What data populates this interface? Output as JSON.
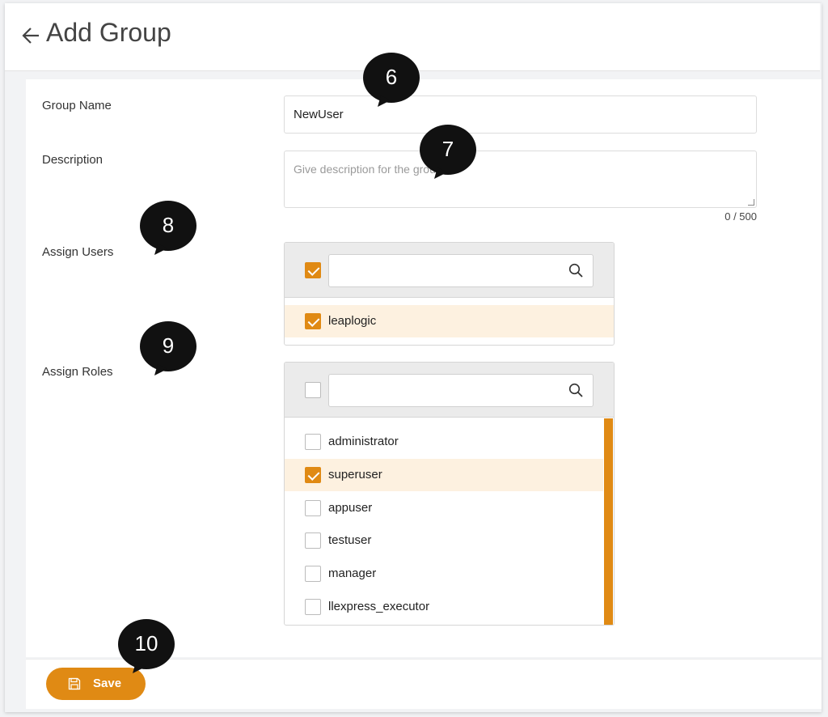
{
  "header": {
    "title": "Add Group",
    "back_icon": "arrow-left-icon"
  },
  "form": {
    "group_name": {
      "label": "Group Name",
      "value": "NewUser"
    },
    "description": {
      "label": "Description",
      "placeholder": "Give description for the group",
      "counter": "0 / 500"
    },
    "assign_users": {
      "label": "Assign Users",
      "select_all_checked": true,
      "items": [
        {
          "label": "leaplogic",
          "checked": true
        }
      ]
    },
    "assign_roles": {
      "label": "Assign Roles",
      "select_all_checked": false,
      "items": [
        {
          "label": "administrator",
          "checked": false
        },
        {
          "label": "superuser",
          "checked": true
        },
        {
          "label": "appuser",
          "checked": false
        },
        {
          "label": "testuser",
          "checked": false
        },
        {
          "label": "manager",
          "checked": false
        },
        {
          "label": "llexpress_executor",
          "checked": false
        }
      ]
    }
  },
  "footer": {
    "save_label": "Save",
    "save_icon": "floppy-disk-icon"
  },
  "callouts": [
    "6",
    "7",
    "8",
    "9",
    "10"
  ],
  "colors": {
    "accent": "#e08a14",
    "selected_row": "#fdf1e0",
    "callout": "#111111"
  }
}
